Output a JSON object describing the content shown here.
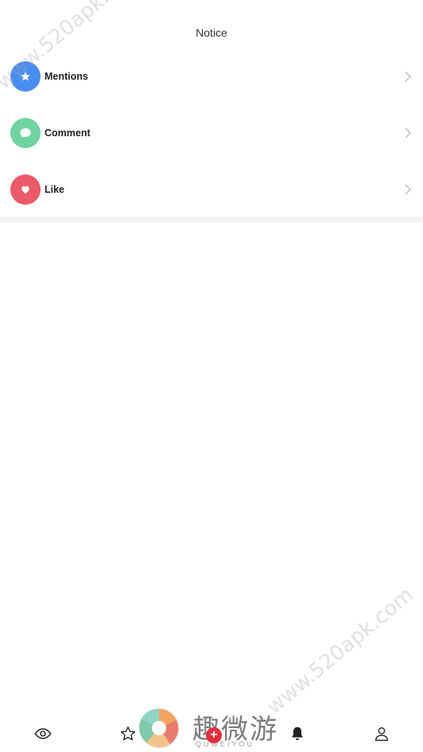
{
  "header": {
    "title": "Notice"
  },
  "notices": [
    {
      "label": "Mentions",
      "icon": "star-icon",
      "color": "#4a8df0"
    },
    {
      "label": "Comment",
      "icon": "comment-icon",
      "color": "#6fd3a0"
    },
    {
      "label": "Like",
      "icon": "heart-icon",
      "color": "#ea5a68"
    }
  ],
  "watermark": {
    "text": "www.520apk.com"
  },
  "logo": {
    "text": "趣微游",
    "subtext": "QUWEIYOU"
  },
  "bottom_nav": [
    {
      "name": "eye-icon"
    },
    {
      "name": "star-outline-icon"
    },
    {
      "name": "add-icon"
    },
    {
      "name": "bell-icon"
    },
    {
      "name": "user-icon"
    }
  ],
  "colors": {
    "add_button": "#e2303c",
    "divider": "#f4f4f4"
  }
}
